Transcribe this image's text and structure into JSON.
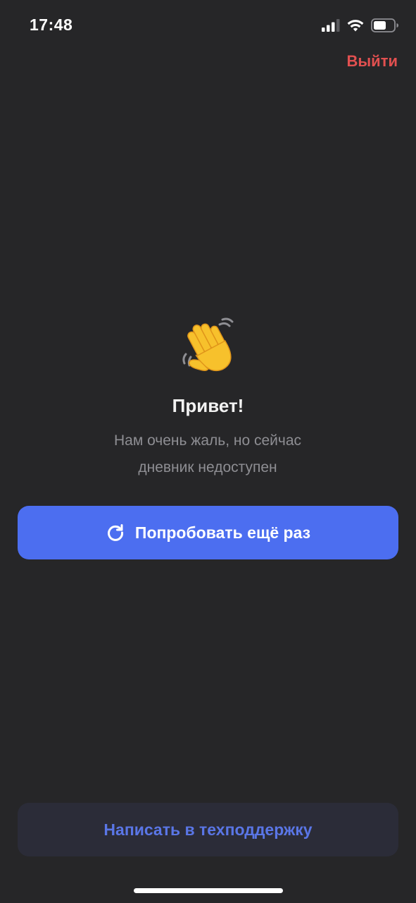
{
  "status_bar": {
    "time": "17:48",
    "icons": [
      "signal-icon",
      "wifi-icon",
      "battery-icon"
    ]
  },
  "header": {
    "logout_label": "Выйти"
  },
  "main": {
    "icon": "waving-hand-icon",
    "title": "Привет!",
    "subtitle_line1": "Нам очень жаль, но сейчас",
    "subtitle_line2": "дневник недоступен",
    "retry_icon": "refresh-icon",
    "retry_label": "Попробовать ещё раз"
  },
  "footer": {
    "support_label": "Написать в техподдержку"
  },
  "colors": {
    "background": "#262628",
    "accent": "#4c6ef0",
    "logout": "#e25050",
    "support_bg": "#2b2c38",
    "support_text": "#5a76e6"
  }
}
